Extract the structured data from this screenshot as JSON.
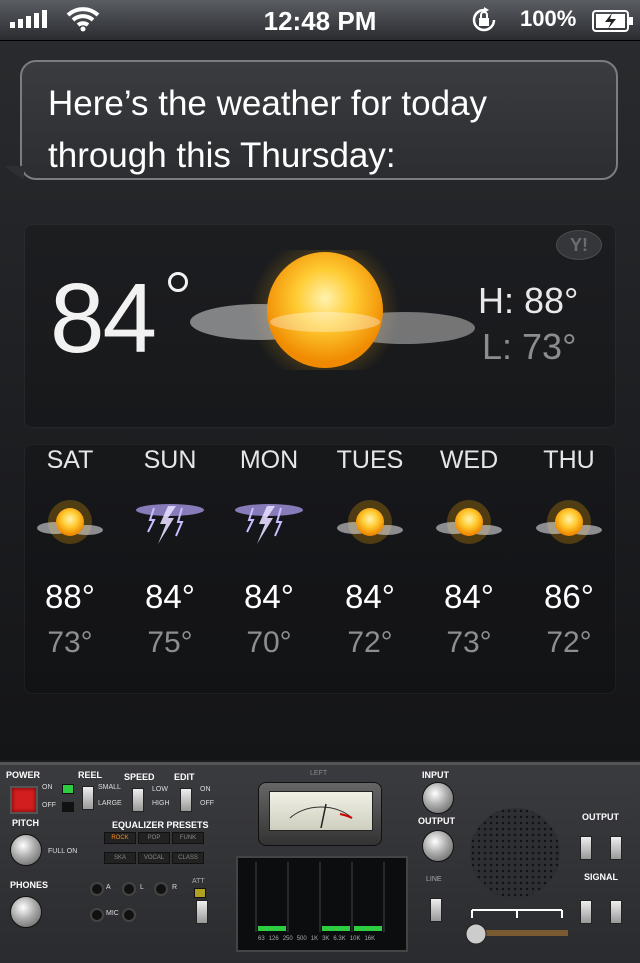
{
  "status_bar": {
    "time": "12:48 PM",
    "battery": "100%",
    "icons": [
      "signal-icon",
      "wifi-icon",
      "rotation-lock-icon",
      "battery-charging-icon"
    ]
  },
  "siri": {
    "message": "Here’s the weather for today through this Thursday:"
  },
  "current": {
    "temperature": "84",
    "high": "H: 88°",
    "low": "L: 73°",
    "condition_icon": "sun-cloud-icon",
    "provider_logo": "Y!"
  },
  "forecast": [
    {
      "day": "SAT",
      "high": "88°",
      "low": "73°",
      "icon": "sun-cloud-icon"
    },
    {
      "day": "SUN",
      "high": "84°",
      "low": "75°",
      "icon": "thunderstorm-icon"
    },
    {
      "day": "MON",
      "high": "84°",
      "low": "70°",
      "icon": "thunderstorm-icon"
    },
    {
      "day": "TUES",
      "high": "84°",
      "low": "72°",
      "icon": "sun-cloud-icon"
    },
    {
      "day": "WED",
      "high": "84°",
      "low": "73°",
      "icon": "sun-cloud-icon"
    },
    {
      "day": "THU",
      "high": "86°",
      "low": "72°",
      "icon": "sun-cloud-icon"
    }
  ],
  "deck": {
    "power": "POWER",
    "on": "ON",
    "off": "OFF",
    "reel": "REEL",
    "small": "SMALL",
    "large": "LARGE",
    "speed": "SPEED",
    "speed_low": "LOW",
    "speed_high": "HIGH",
    "edit": "EDIT",
    "edit_on": "ON",
    "edit_off": "OFF",
    "pitch": "PITCH",
    "full_on": "FULL ON",
    "eq_presets": "EQUALIZER PRESETS",
    "presets": [
      "ROCK",
      "POP",
      "FUNK",
      "SKA",
      "VOCAL",
      "CLASS"
    ],
    "phones": "PHONES",
    "jacks": [
      "A",
      "L",
      "R"
    ],
    "mic": "MIC",
    "att": "ATT",
    "meter_label": "LEFT",
    "input": "INPUT",
    "output": "OUTPUT",
    "line": "LINE",
    "output_right": "OUTPUT",
    "signal": "SIGNAL",
    "eq_freqs": [
      "63",
      "126",
      "250",
      "500",
      "1K",
      "3K",
      "6.3K",
      "10K",
      "16K"
    ],
    "colors": {
      "power": "#d21e1e",
      "led_green": "#2ecc40",
      "preset_active": "#ff8c1a"
    }
  }
}
